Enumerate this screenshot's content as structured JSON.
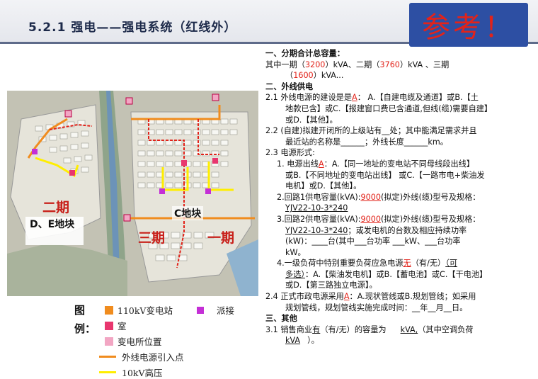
{
  "header": {
    "title": "5.2.1   强电——强电系统（红线外）",
    "stamp": "参考！"
  },
  "map": {
    "label_phase2": "二期",
    "label_de": "D、E地块",
    "label_c": "C地块",
    "label_phase3": "三期",
    "label_phase1": "一期"
  },
  "legend": {
    "title_top": "图",
    "title_bottom": "例：",
    "items": [
      {
        "label": "110kV变电站",
        "color": "#f08c1e"
      },
      {
        "label": "派接",
        "color": "#c42fd6"
      },
      {
        "label": "室",
        "color": "#e8366e"
      },
      {
        "label": "变电所位置",
        "color": "#f2a6c3"
      },
      {
        "label": "外线电源引入点",
        "color": "#f08c1e"
      },
      {
        "label": "10kV高压",
        "color": "#ffee00"
      }
    ]
  },
  "content": {
    "s1_title": "一、分期合计总容量：",
    "s1_l1_a": "其中一期（",
    "s1_l1_v1": "3200",
    "s1_l1_b": "）kVA、二期（",
    "s1_l1_v2": "3760",
    "s1_l1_c": "）kVA 、三期",
    "s1_l2_a": "（",
    "s1_l2_v": "1600",
    "s1_l2_b": "）kVA...",
    "s2_title": "二、外线供电",
    "p21_a": "2.1 外线电源的建设是是",
    "p21_ans": "A",
    "p21_b": "：  A.【自建电缆及通道】或B.【土",
    "p21_l2": "地款已含】或C.【报建窗口费已含通道,但线(缆)需要自建】",
    "p21_l3": "或D.【其他】。",
    "p22_l1": "2.2 (自建)拟建开闭所的上级站有__处；其中能满足需求并且",
    "p22_l2": "最近站的名称是______；外线长度______km。",
    "p23_title": "2.3 电源形式:",
    "p23_1_a": "1. 电源出线",
    "p23_1_ans": "A",
    "p23_1_b": "：A.【同一地址的变电站不同母线段出线】",
    "p23_1_l2": "或B.【不同地址的变电站出线】  或C.【一路市电+柴油发",
    "p23_1_l3": "电机】或D.【其他】。",
    "p23_2_a": "2.回路1供电容量(kVA):",
    "p23_2_v": "9000",
    "p23_2_b": "(拟定)外线(缆)型号及规格：",
    "p23_2_l2": "YJV22-10-3*240",
    "p23_3_a": "3.回路2供电容量(kVA):",
    "p23_3_v": "9000",
    "p23_3_b": "(拟定)外线(缆)型号及规格：",
    "p23_3_l2a": "YJV22-10-3*240",
    "p23_3_l2b": "；或发电机的台数及相应持续功率",
    "p23_3_l3": "(kW)：____台(其中___台功率 ___kW、___台功率",
    "p23_3_l4": "kW。",
    "p23_4_a": "4.一级负荷中特别重要负荷应急电源",
    "p23_4_ans": "无",
    "p23_4_b": "（有/无）",
    "p23_4_c": "（可",
    "p23_4_l2a": "多选）",
    "p23_4_l2b": "：A.【柴油发电机】或B.【蓄电池】或C.【干电池】",
    "p23_4_l3": "或D.【第三路独立电源】。",
    "p24_a": "2.4 正式市政电源采用",
    "p24_ans": "A",
    "p24_b": "：A.现状管线或B.规划管线；如采用",
    "p24_l2": "规划管线，规划管线实施完成时间：__年__月__日。",
    "s3_title": "三、其他",
    "p31_a": "3.1 销售商业",
    "p31_v": "有",
    "p31_b": "（有/无）的容量为",
    "p31_c": "kVA,",
    "p31_d": "（其中空调负荷",
    "p31_l2": "kVA",
    "p31_l2b": "）。"
  }
}
